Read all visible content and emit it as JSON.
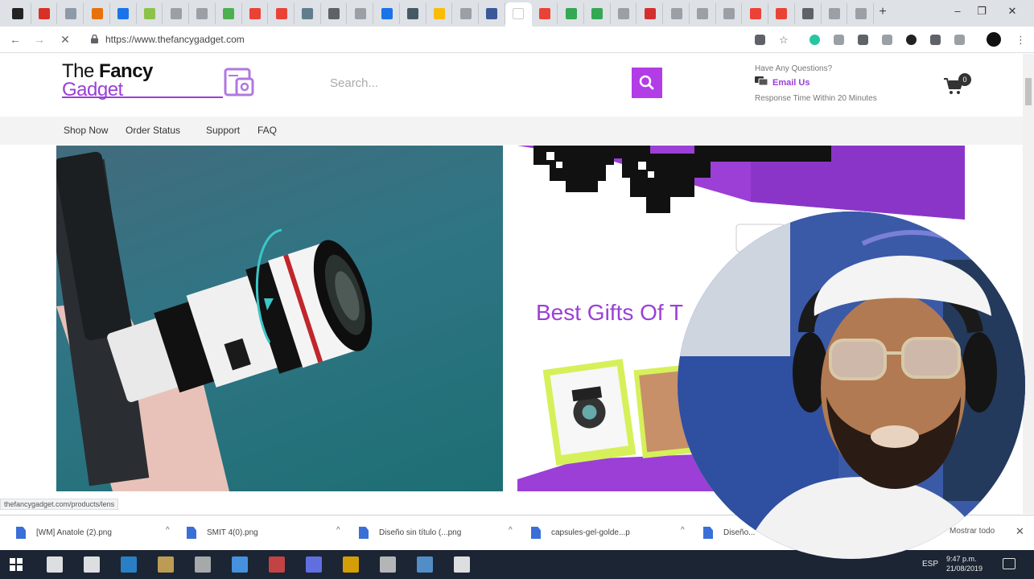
{
  "browser": {
    "url": "https://www.thefancygadget.com",
    "tab_count": 33,
    "tab_favicon_colors": [
      "#222222",
      "#d93025",
      "#8e9aa8",
      "#e8710a",
      "#1a73e8",
      "#8bc34a",
      "#9aa0a6",
      "#9aa0a6",
      "#4caf50",
      "#ea4335",
      "#ea4335",
      "#607d8b",
      "#5f6368",
      "#9aa0a6",
      "#1a73e8",
      "#455a64",
      "#fbbc04",
      "#9aa0a6",
      "#3b5998",
      "#ffffff",
      "#ea4335",
      "#34a853",
      "#34a853",
      "#9aa0a6",
      "#d32f2f",
      "#9aa0a6",
      "#9aa0a6",
      "#9aa0a6",
      "#ea4335",
      "#ea4335",
      "#5f6368",
      "#9aa0a6",
      "#9aa0a6"
    ],
    "active_tab_index": 19,
    "new_tab_label": "+",
    "window_controls": {
      "minimize": "–",
      "maximize": "❐",
      "close": "✕"
    },
    "nav": {
      "back": "←",
      "forward": "→",
      "stop": "✕"
    }
  },
  "site": {
    "logo_line1_normal": "The ",
    "logo_line1_bold": "Fancy",
    "logo_line2": "Gadget",
    "search_placeholder": "Search...",
    "contact_question": "Have Any Questions?",
    "contact_email_label": "Email Us",
    "contact_response_time": "Response Time Within 20 Minutes",
    "cart_count": "0",
    "nav": [
      "Shop Now",
      "Order Status",
      "Support",
      "FAQ"
    ],
    "hero_right_title": "Best Gifts Of T",
    "brand_color": "#9b3fd6",
    "accent_color": "#b23ce6"
  },
  "status_url": "thefancygadget.com/products/lens",
  "downloads": {
    "items": [
      "[WM] Anatole (2).png",
      "SMIT 4(0).png",
      "Diseño sin título (...png",
      "capsules-gel-golde...p",
      "Diseño..."
    ],
    "caret": "^",
    "show_all": "Mostrar todo",
    "close": "✕"
  },
  "taskbar": {
    "lang": "ESP",
    "time": "9:47 p.m.",
    "date": "21/08/2019",
    "icon_colors": [
      "#ffffff",
      "#ffffff",
      "#2b8fe0",
      "#d8b25a",
      "#c0c0c0",
      "#4da3ff",
      "#e04848",
      "#6c7cff",
      "#f4b400",
      "#cfcfcf",
      "#5aa0e0",
      "#ffffff"
    ]
  }
}
